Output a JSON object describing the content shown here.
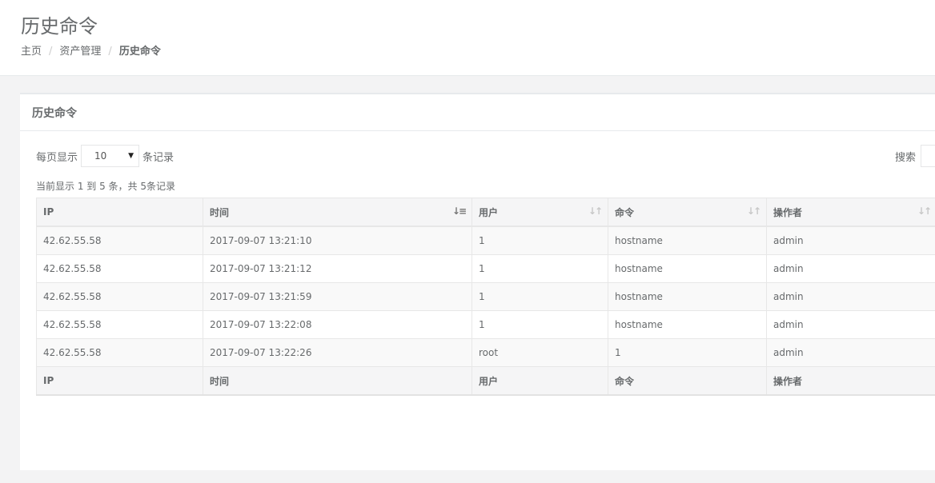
{
  "page": {
    "title": "历史命令",
    "breadcrumb": [
      {
        "label": "主页"
      },
      {
        "label": "资产管理"
      },
      {
        "label": "历史命令"
      }
    ],
    "breadcrumb_sep": "/"
  },
  "panel": {
    "title": "历史命令",
    "length_prefix": "每页显示",
    "length_value": "10",
    "length_suffix": "条记录",
    "search_label": "搜索",
    "info": "当前显示 1 到 5 条，共 5条记录"
  },
  "table": {
    "columns": [
      "IP",
      "时间",
      "用户",
      "命令",
      "操作者"
    ],
    "rows": [
      [
        "42.62.55.58",
        "2017-09-07 13:21:10",
        "1",
        "hostname",
        "admin"
      ],
      [
        "42.62.55.58",
        "2017-09-07 13:21:12",
        "1",
        "hostname",
        "admin"
      ],
      [
        "42.62.55.58",
        "2017-09-07 13:21:59",
        "1",
        "hostname",
        "admin"
      ],
      [
        "42.62.55.58",
        "2017-09-07 13:22:08",
        "1",
        "hostname",
        "admin"
      ],
      [
        "42.62.55.58",
        "2017-09-07 13:22:26",
        "root",
        "1",
        "admin"
      ]
    ]
  }
}
